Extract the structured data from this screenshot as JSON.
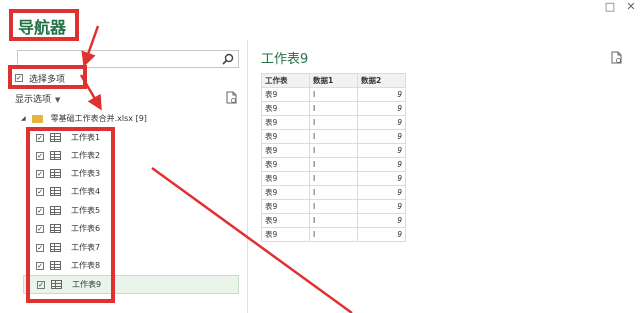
{
  "navigator": {
    "title": "导航器",
    "search_placeholder": "",
    "multi_select_label": "选择多项",
    "display_options_label": "显示选项",
    "file_name": "零基础工作表合并.xlsx [9]",
    "items": [
      {
        "label": "工作表1",
        "checked": true
      },
      {
        "label": "工作表2",
        "checked": true
      },
      {
        "label": "工作表3",
        "checked": true
      },
      {
        "label": "工作表4",
        "checked": true
      },
      {
        "label": "工作表5",
        "checked": true
      },
      {
        "label": "工作表6",
        "checked": true
      },
      {
        "label": "工作表7",
        "checked": true
      },
      {
        "label": "工作表8",
        "checked": true
      },
      {
        "label": "工作表9",
        "checked": true,
        "selected": true
      }
    ]
  },
  "preview": {
    "title": "工作表9",
    "columns": [
      "工作表",
      "数据1",
      "数据2"
    ],
    "rows": [
      [
        "表9",
        "I",
        "9"
      ],
      [
        "表9",
        "I",
        "9"
      ],
      [
        "表9",
        "I",
        "9"
      ],
      [
        "表9",
        "I",
        "9"
      ],
      [
        "表9",
        "I",
        "9"
      ],
      [
        "表9",
        "I",
        "9"
      ],
      [
        "表9",
        "I",
        "9"
      ],
      [
        "表9",
        "I",
        "9"
      ],
      [
        "表9",
        "I",
        "9"
      ],
      [
        "表9",
        "I",
        "9"
      ],
      [
        "表9",
        "I",
        "9"
      ]
    ]
  },
  "window": {
    "maximize_glyph": "□",
    "close_glyph": "✕"
  },
  "colors": {
    "accent": "#217346",
    "highlight": "#e03131"
  }
}
